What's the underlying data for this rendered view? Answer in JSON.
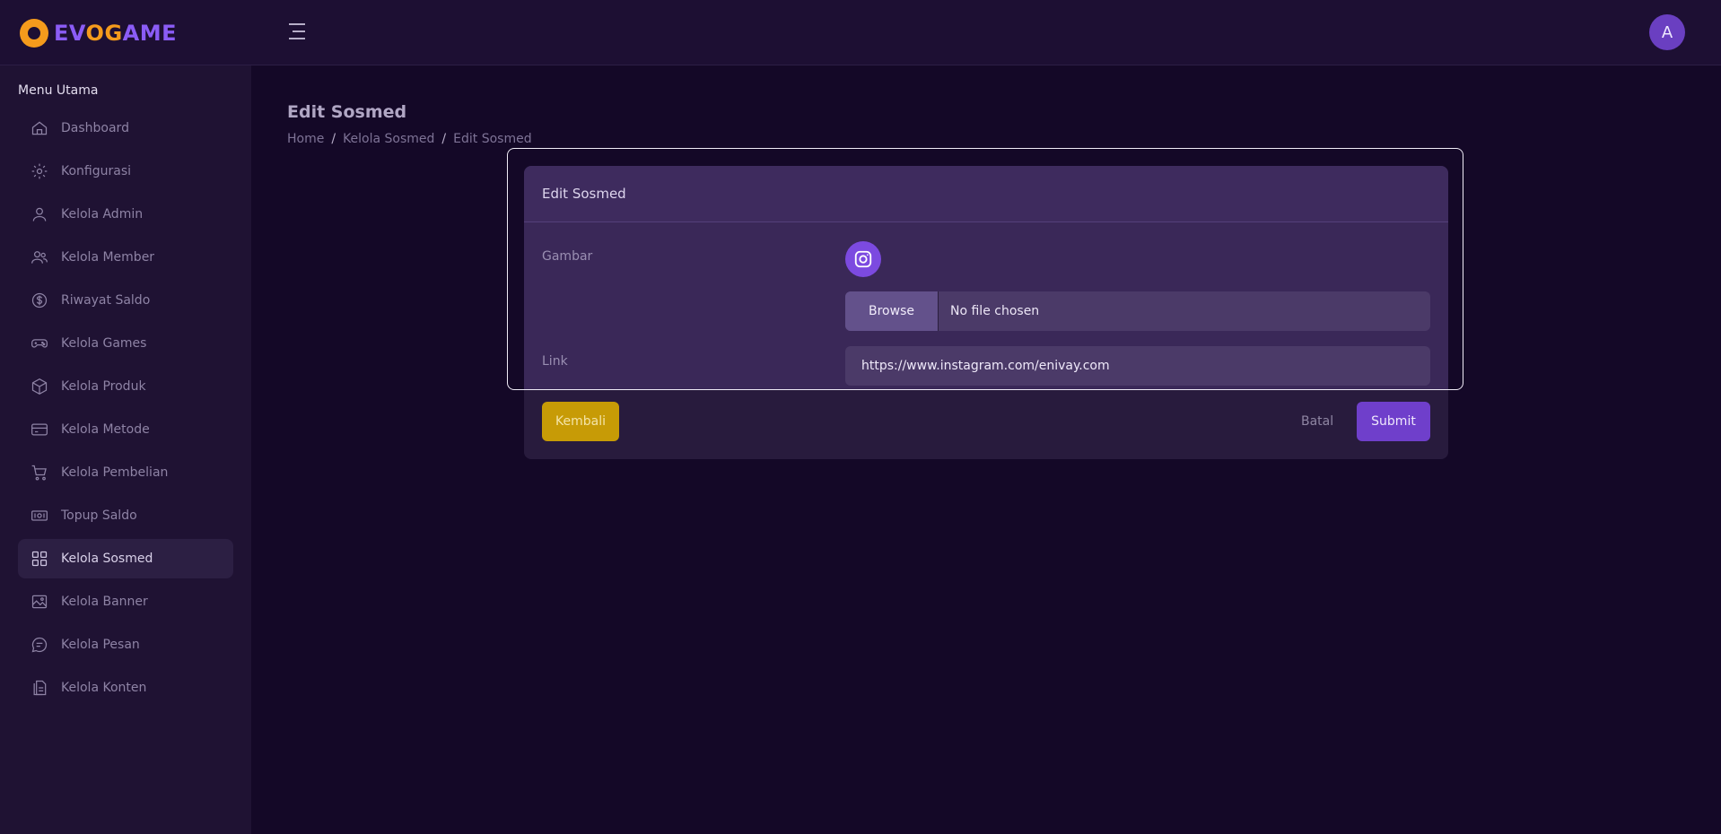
{
  "app": {
    "brand": {
      "evo_prefix": "EV",
      "evo_o": "O",
      "game_g": "G",
      "game_rest": "AME"
    },
    "avatar_letter": "A"
  },
  "sidebar": {
    "title": "Menu Utama",
    "items": [
      {
        "label": "Dashboard",
        "icon": "home-icon"
      },
      {
        "label": "Konfigurasi",
        "icon": "gear-icon"
      },
      {
        "label": "Kelola Admin",
        "icon": "user-icon"
      },
      {
        "label": "Kelola Member",
        "icon": "users-icon"
      },
      {
        "label": "Riwayat Saldo",
        "icon": "dollar-circle-icon"
      },
      {
        "label": "Kelola Games",
        "icon": "gamepad-icon"
      },
      {
        "label": "Kelola Produk",
        "icon": "box-icon"
      },
      {
        "label": "Kelola Metode",
        "icon": "card-icon"
      },
      {
        "label": "Kelola Pembelian",
        "icon": "cart-icon"
      },
      {
        "label": "Topup Saldo",
        "icon": "cash-icon"
      },
      {
        "label": "Kelola Sosmed",
        "icon": "grid-icon"
      },
      {
        "label": "Kelola Banner",
        "icon": "image-icon"
      },
      {
        "label": "Kelola Pesan",
        "icon": "chat-icon"
      },
      {
        "label": "Kelola Konten",
        "icon": "document-icon"
      }
    ],
    "active_index": 10
  },
  "page": {
    "title": "Edit Sosmed",
    "breadcrumb": [
      "Home",
      "Kelola Sosmed",
      "Edit Sosmed"
    ],
    "breadcrumb_separator": "/"
  },
  "form": {
    "card_title": "Edit Sosmed",
    "image_label": "Gambar",
    "image_icon": "instagram-icon",
    "browse_label": "Browse",
    "file_status": "No file chosen",
    "link_label": "Link",
    "link_value": "https://www.instagram.com/enivay.com",
    "back_label": "Kembali",
    "cancel_label": "Batal",
    "submit_label": "Submit"
  },
  "colors": {
    "accent": "#6f3fcb",
    "warning": "#c79b06",
    "brand_orange": "#f59b1c",
    "brand_purple": "#8b5cf6"
  }
}
